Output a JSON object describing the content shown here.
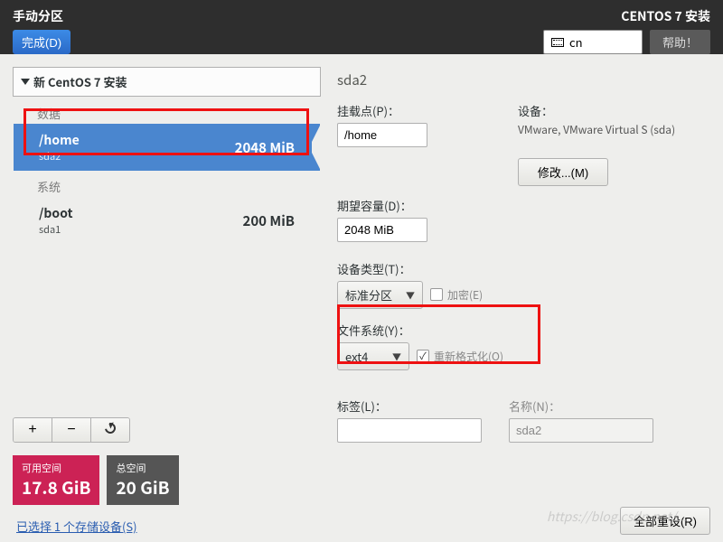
{
  "header": {
    "title": "手动分区",
    "done": "完成(D)",
    "install_title": "CENTOS 7 安装",
    "keyboard": "cn",
    "help": "帮助！"
  },
  "left": {
    "install_label": "新 CentOS 7 安装",
    "section_data": "数据",
    "section_system": "系统",
    "partitions": [
      {
        "mount": "/home",
        "device": "sda2",
        "size": "2048 MiB",
        "selected": true
      },
      {
        "mount": "/boot",
        "device": "sda1",
        "size": "200 MiB",
        "selected": false
      }
    ],
    "space": {
      "avail_label": "可用空间",
      "avail_val": "17.8 GiB",
      "total_label": "总空间",
      "total_val": "20 GiB"
    },
    "devices_selected_link": "已选择 1 个存储设备(S)"
  },
  "right": {
    "device_header": "sda2",
    "mountpoint_label": "挂载点(P)：",
    "mountpoint_value": "/home",
    "device_section_label": "设备：",
    "device_text": "VMware, VMware Virtual S (sda)",
    "modify_btn": "修改...(M)",
    "desired_label": "期望容量(D)：",
    "desired_value": "2048 MiB",
    "devtype_label": "设备类型(T)：",
    "devtype_value": "标准分区",
    "encrypt_label": "加密(E)",
    "fs_label": "文件系统(Y)：",
    "fs_value": "ext4",
    "reformat_label": "重新格式化(O)",
    "label_label": "标签(L)：",
    "label_value": "",
    "name_label": "名称(N)：",
    "name_value": "sda2",
    "reset_btn": "全部重设(R)"
  }
}
